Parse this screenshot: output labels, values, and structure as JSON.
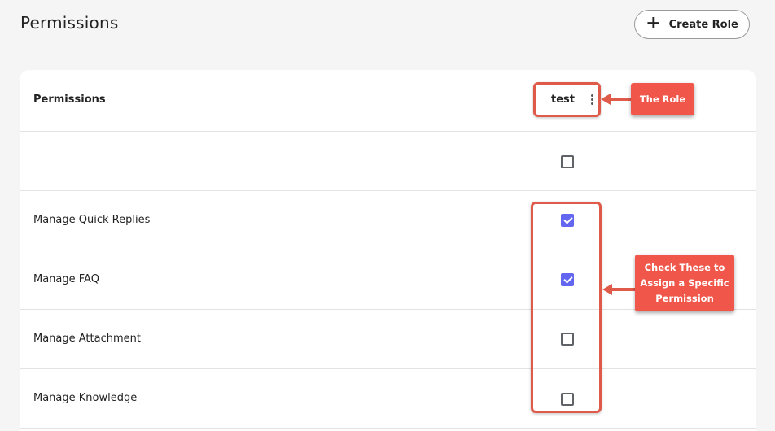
{
  "page": {
    "title": "Permissions"
  },
  "toolbar": {
    "create_role_label": "Create Role",
    "create_role_icon": "plus-icon"
  },
  "table": {
    "header_label": "Permissions",
    "role_name": "test",
    "role_menu_icon": "more-vertical-icon",
    "rows": [
      {
        "label": "",
        "checked": false
      },
      {
        "label": "Manage Quick Replies",
        "checked": true
      },
      {
        "label": "Manage FAQ",
        "checked": true
      },
      {
        "label": "Manage Attachment",
        "checked": false
      },
      {
        "label": "Manage Knowledge",
        "checked": false
      }
    ]
  },
  "annotations": {
    "role_callout": "The Role",
    "checkbox_callout_line1": "Check These to",
    "checkbox_callout_line2": "Assign a Specific",
    "checkbox_callout_line3": "Permission",
    "color": "#f0574a"
  },
  "colors": {
    "accent": "#6366f1",
    "background": "#f5f5f6",
    "card": "#ffffff"
  }
}
